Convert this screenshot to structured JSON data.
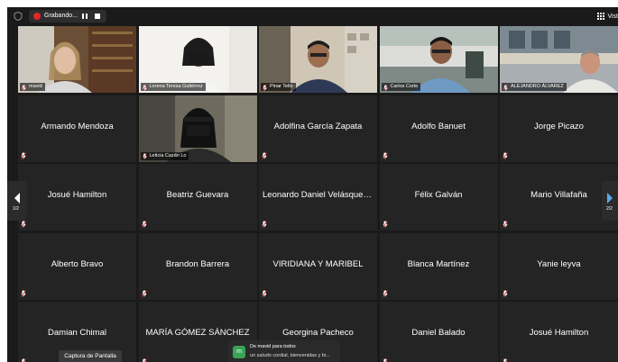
{
  "topbar": {
    "recording_label": "Grabando...",
    "view_label": "Vist",
    "rec_color": "#e02828"
  },
  "tiles": [
    {
      "name": "mavid",
      "video": true
    },
    {
      "name": "Lorena Teresa Gutiérrez",
      "video": true
    },
    {
      "name": "Pinar Tello",
      "video": true,
      "active": true
    },
    {
      "name": "Carlos Corte",
      "video": true
    },
    {
      "name": "ALEJANDRO ÁLVAREZ",
      "video": true
    },
    {
      "name": "Armando Mendoza",
      "video": false
    },
    {
      "name": "Leticia Cazán Lo",
      "video": true
    },
    {
      "name": "Adolfina García Zapata",
      "video": false
    },
    {
      "name": "Adolfo Banuet",
      "video": false
    },
    {
      "name": "Jorge Picazo",
      "video": false
    },
    {
      "name": "Josué Hamilton",
      "video": false
    },
    {
      "name": "Beatriz Guevara",
      "video": false
    },
    {
      "name": "Leonardo Daniel Velásquez...",
      "video": false
    },
    {
      "name": "Félix Galván",
      "video": false
    },
    {
      "name": "Mario Villafaña",
      "video": false
    },
    {
      "name": "Alberto Bravo",
      "video": false
    },
    {
      "name": "Brandon Barrera",
      "video": false
    },
    {
      "name": "VIRIDIANA Y MARIBEL",
      "video": false
    },
    {
      "name": "Blanca Martínez",
      "video": false
    },
    {
      "name": "Yanie leyva",
      "video": false
    },
    {
      "name": "Damian Chimal",
      "video": false
    },
    {
      "name": "MARÍA GÓMEZ SÁNCHEZ",
      "video": false
    },
    {
      "name": "Georgina Pacheco",
      "video": false
    },
    {
      "name": "Daniel Balado",
      "video": false
    },
    {
      "name": "Josué Hamilton",
      "video": false
    }
  ],
  "nav": {
    "left_page": "1/2",
    "right_page": "2/2"
  },
  "tooltip": "Captura de Pantalla",
  "toast": {
    "avatar_letter": "m",
    "title": "De mavid para todos",
    "body": "un saludo cordial, bienvenidas y bi..."
  },
  "colors": {
    "background": "#1a1a1a",
    "tile": "#242424",
    "active_border": "#d3c56a",
    "avatar": "#3aa357"
  }
}
